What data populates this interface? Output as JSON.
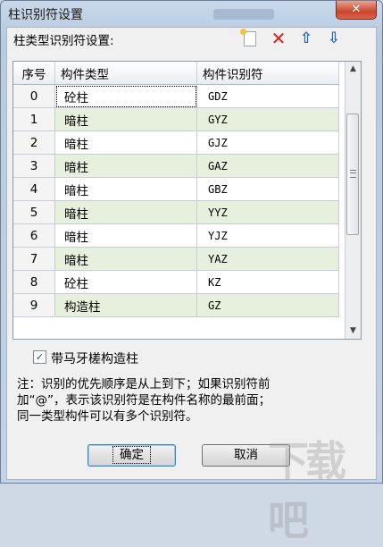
{
  "window": {
    "title": "柱识别符设置",
    "close_glyph": "✕"
  },
  "section": {
    "label": "柱类型识别符设置:"
  },
  "toolbar": {
    "new_icon": "new-icon",
    "delete_glyph": "✕",
    "up_glyph": "⇧",
    "down_glyph": "⇩"
  },
  "table": {
    "headers": [
      "序号",
      "构件类型",
      "构件识别符"
    ],
    "rows": [
      {
        "seq": "0",
        "type": "砼柱",
        "code": "GDZ"
      },
      {
        "seq": "1",
        "type": "暗柱",
        "code": "GYZ"
      },
      {
        "seq": "2",
        "type": "暗柱",
        "code": "GJZ"
      },
      {
        "seq": "3",
        "type": "暗柱",
        "code": "GAZ"
      },
      {
        "seq": "4",
        "type": "暗柱",
        "code": "GBZ"
      },
      {
        "seq": "5",
        "type": "暗柱",
        "code": "YYZ"
      },
      {
        "seq": "6",
        "type": "暗柱",
        "code": "YJZ"
      },
      {
        "seq": "7",
        "type": "暗柱",
        "code": "YAZ"
      },
      {
        "seq": "8",
        "type": "砼柱",
        "code": "KZ"
      },
      {
        "seq": "9",
        "type": "构造柱",
        "code": "GZ"
      }
    ]
  },
  "option": {
    "checked": true,
    "check_glyph": "✓",
    "label": "带马牙槎构造柱"
  },
  "note": {
    "line1": "注：识别的优先顺序是从上到下；如果识别符前",
    "line2": "加“@”，表示该识别符是在构件名称的最前面；",
    "line3": "同一类型构件可以有多个识别符。"
  },
  "buttons": {
    "ok": "确定",
    "cancel": "取消"
  },
  "colors": {
    "alt_row": "#e7f0dc",
    "delete": "#d8221b",
    "arrow": "#2168c9"
  }
}
